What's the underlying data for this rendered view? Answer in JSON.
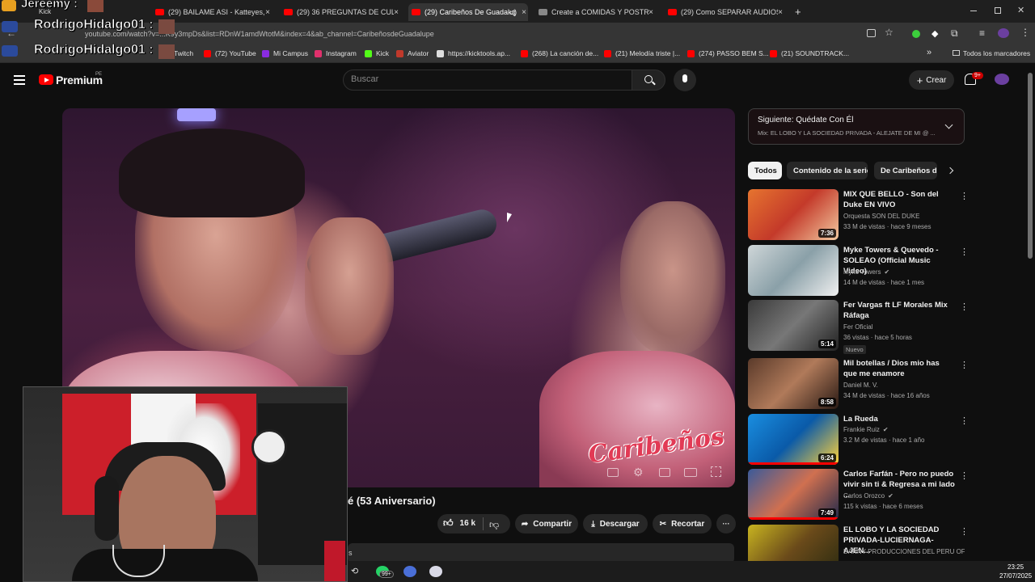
{
  "overlays": {
    "name_top": "Jereemy :",
    "name_top_sub": "Kick",
    "name_repeat_1": "RodrigoHidalgo01 :",
    "name_repeat_2": "RodrigoHidalgo01 :"
  },
  "browser": {
    "tabs": [
      {
        "label": "(29) BAILAME ASI - Katteyes, Je",
        "active": false
      },
      {
        "label": "(29) 36 PREGUNTAS DE CULTUR",
        "active": false
      },
      {
        "label": "(29) Caribeños De Guadalup",
        "active": true
      },
      {
        "label": "Create a COMIDAS Y POSTRES",
        "active": false
      },
      {
        "label": "(29) Como SEPARAR AUDIOS e",
        "active": false
      }
    ],
    "new_tab": "+",
    "url": "youtube.com/watch?v=...K9y3mpDs&list=RDnW1amdWtotM&index=4&ab_channel=CaribeñosdeGuadalupe",
    "bookmarks": [
      {
        "label": "Twitch",
        "color": "#9146ff"
      },
      {
        "label": "(72) YouTube",
        "color": "#ff0000"
      },
      {
        "label": "Mi Campus",
        "color": "#8a2be2"
      },
      {
        "label": "Instagram",
        "color": "#e1306c"
      },
      {
        "label": "Kick",
        "color": "#53fc18"
      },
      {
        "label": "Aviator",
        "color": "#c0392b"
      },
      {
        "label": "https://kicktools.ap...",
        "color": "#dddddd"
      },
      {
        "label": "(268) La canción de...",
        "color": "#ff0000"
      },
      {
        "label": "(21) Melodía triste |...",
        "color": "#ff0000"
      },
      {
        "label": "(274) PASSO BEM S...",
        "color": "#ff0000"
      },
      {
        "label": "(21) SOUNDTRACK...",
        "color": "#ff0000"
      }
    ],
    "all_bookmarks": "Todos los marcadores"
  },
  "header": {
    "logo_text": "Premium",
    "region": "PE",
    "search_placeholder": "Buscar",
    "create_label": "Crear",
    "notifications": "9+"
  },
  "video": {
    "watermark": "Caribeños",
    "title": "é (53 Aniversario)",
    "likes": "16 k",
    "share": "Compartir",
    "download": "Descargar",
    "clip": "Recortar",
    "more": "···",
    "desc_hint": "s"
  },
  "up_next": {
    "label_prefix": "Siguiente: ",
    "label_title": "Quédate Con Él",
    "subtitle": "Mix: EL LOBO Y LA SOCIEDAD PRIVADA - ALEJATE DE MI @ ..."
  },
  "chips": [
    "Todos",
    "Contenido de la serie",
    "De Caribeños de"
  ],
  "recommendations": [
    {
      "title": "MIX QUE BELLO - Son del Duke EN VIVO",
      "channel": "Orquesta SON DEL DUKE",
      "meta": "33 M de vistas · hace 9 meses",
      "duration": "7:36",
      "verified": false,
      "new": false,
      "progress": 0
    },
    {
      "title": "Myke Towers & Quevedo - SOLEAO (Official Music Video)",
      "channel": "Myke Towers",
      "meta": "14 M de vistas · hace 1 mes",
      "duration": "",
      "verified": true,
      "new": false,
      "progress": 0
    },
    {
      "title": "Fer Vargas ft LF Morales Mix Ráfaga",
      "channel": "Fer Oficial",
      "meta": "36 vistas · hace 5 horas",
      "duration": "5:14",
      "verified": false,
      "new": true,
      "new_label": "Nuevo",
      "progress": 0
    },
    {
      "title": "Mil botellas / Dios mio has que me enamore",
      "channel": "Daniel M. V.",
      "meta": "34 M de vistas · hace 16 años",
      "duration": "8:58",
      "verified": false,
      "new": false,
      "progress": 0
    },
    {
      "title": "La Rueda",
      "channel": "Frankie Ruiz",
      "meta": "3.2 M de vistas · hace 1 año",
      "duration": "6:24",
      "verified": true,
      "new": false,
      "progress": 1
    },
    {
      "title": "Carlos Farfán - Pero no puedo vivir sin ti & Regresa a mi lado ...",
      "channel": "Carlos Orozco",
      "meta": "115 k vistas · hace 6 meses",
      "duration": "7:49",
      "verified": true,
      "new": false,
      "progress": 1
    },
    {
      "title": "EL LOBO Y LA SOCIEDAD PRIVADA-LUCIERNAGA-AJEN...",
      "channel": "DANNY PRODUCCIONES DEL PERU OFIC...",
      "meta": "",
      "duration": "",
      "verified": false,
      "new": false,
      "progress": 0
    }
  ],
  "taskbar": {
    "badge": "99+",
    "time": "23:25",
    "date": "27/07/2025"
  },
  "colors": {
    "accent": "#ff0000",
    "background": "#0f0f0f",
    "chip_active": "#f1f1f1"
  }
}
